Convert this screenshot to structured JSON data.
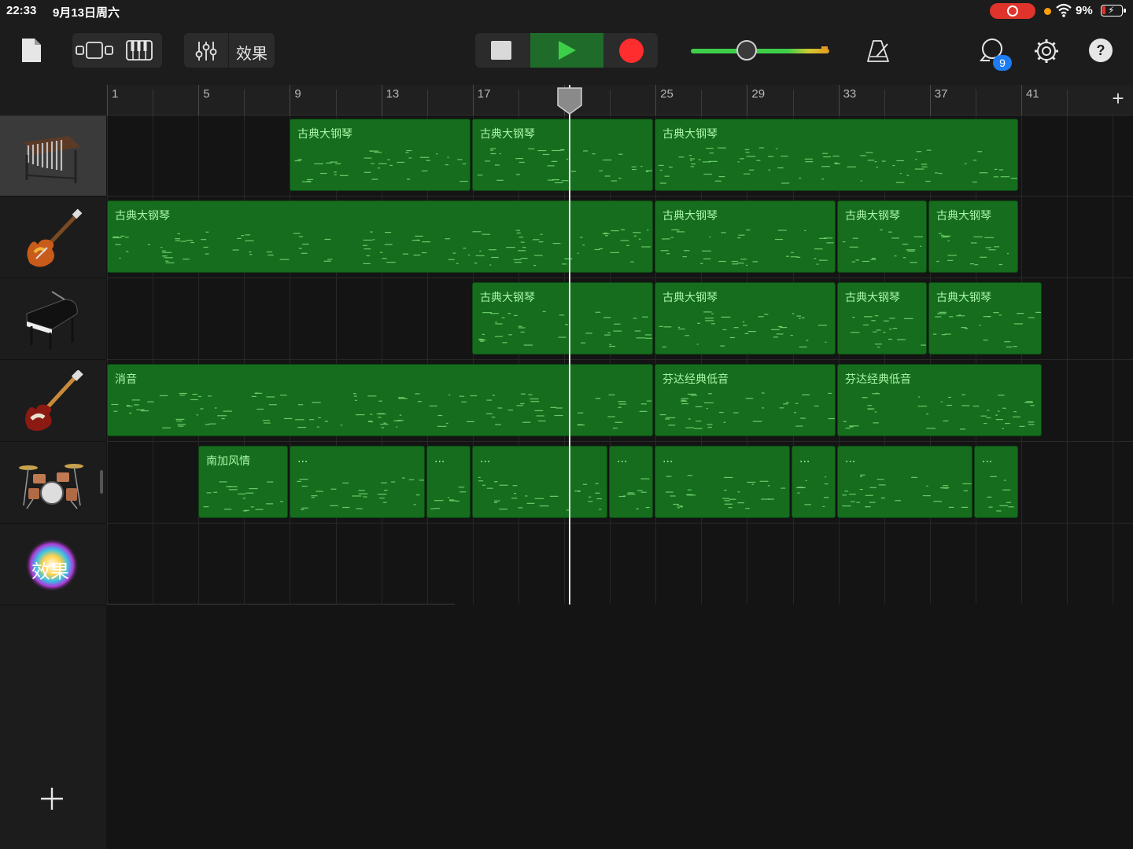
{
  "status_bar": {
    "time": "22:33",
    "date": "9月13日周六",
    "battery": "9%"
  },
  "toolbar": {
    "effects_label": "效果",
    "loop_badge": "9",
    "icons": [
      "document-icon",
      "tracks-view-icon",
      "keyboard-icon",
      "mixer-icon",
      "stop-icon",
      "play-icon",
      "record-icon",
      "master-volume-slider",
      "metronome-icon",
      "loop-browser-icon",
      "settings-gear-icon",
      "help-icon"
    ],
    "play_color": "#3ecf4a",
    "record_color": "#ff2d2d",
    "badge_color": "#1e7cf2"
  },
  "ruler": {
    "bars": [
      "1",
      "5",
      "9",
      "13",
      "17",
      "21",
      "25",
      "29",
      "33",
      "37",
      "41"
    ],
    "playhead_bar": "21"
  },
  "tracks": [
    {
      "id": "mallets",
      "icon": "xylophone-icon",
      "selected": true
    },
    {
      "id": "electric-guitar",
      "icon": "electric-guitar-icon",
      "selected": false
    },
    {
      "id": "grand-piano",
      "icon": "grand-piano-icon",
      "selected": false
    },
    {
      "id": "bass",
      "icon": "bass-guitar-icon",
      "selected": false
    },
    {
      "id": "drums",
      "icon": "drum-kit-icon",
      "selected": false
    },
    {
      "id": "fx",
      "icon": "effects-icon",
      "label": "效果",
      "selected": false
    }
  ],
  "regions": {
    "t1": [
      "古典大钢琴",
      "古典大钢琴",
      "古典大钢琴"
    ],
    "t2": [
      "古典大钢琴",
      "古典大钢琴",
      "古典大钢琴",
      "古典大钢琴"
    ],
    "t3": [
      "古典大钢琴",
      "古典大钢琴",
      "古典大钢琴",
      "古典大钢琴"
    ],
    "t4": [
      "消音",
      "芬达经典低音",
      "芬达经典低音"
    ],
    "t5": [
      "南加风情",
      "...",
      "...",
      "...",
      "...",
      "...",
      "...",
      "...",
      "..."
    ]
  },
  "region_color": "#156d1d"
}
